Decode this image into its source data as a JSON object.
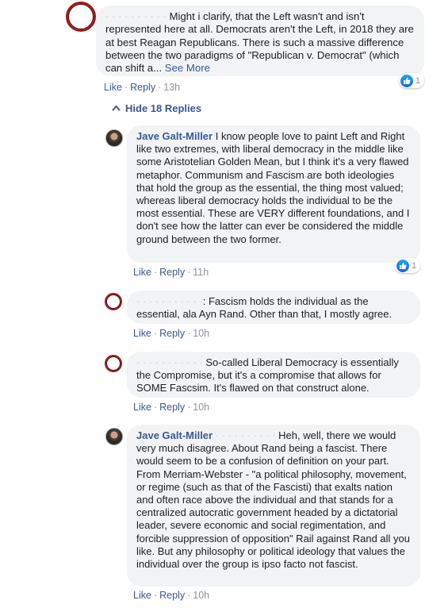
{
  "thread": {
    "top_comment": {
      "masked_name": "· · · · · · · · · ·",
      "text": " Might i clarify, that the Left wasn't and isn't represented here at all. Democrats aren't the Left, in 2018 they are at best Reagan Republicans. There is such a massive difference between the two paradigms of \"Republican v. Democrat\" (which can shift a...",
      "see_more": "See More",
      "like": "Like",
      "reply": "Reply",
      "time": "13h",
      "reaction_count": "1"
    },
    "hide_replies": "Hide 18 Replies",
    "replies": [
      {
        "author": "Jave Galt-Miller",
        "text": " I know people love to paint Left and Right like two extremes, with liberal democracy in the middle like some Aristotelian Golden Mean, but I think it's a very flawed metaphor. Communism and Fascism are both ideologies that hold the group as the essential, the thing most valued; whereas liberal democracy holds the individual to be the most essential. These are VERY different foundations, and I don't see how the latter can ever be considered the middle ground between the two former.",
        "like": "Like",
        "reply": "Reply",
        "time": "11h",
        "reaction_count": "1"
      },
      {
        "masked_name": "· · · · · · · · · · ·",
        "text": ": Fascism holds the individual as the essential, ala Ayn Rand. Other than that, I mostly agree.",
        "like": "Like",
        "reply": "Reply",
        "time": "10h"
      },
      {
        "masked_name": "· · · · · · · · · · ·",
        "text": " So-called Liberal Democracy is essentially the Compromise, but it's a compromise that allows for SOME Fascsim. It's flawed on that construct alone.",
        "like": "Like",
        "reply": "Reply",
        "time": "10h"
      },
      {
        "author": "Jave Galt-Miller",
        "masked_name": "· · · · · · · · · ·",
        "text": " Heh, well, there we would very much disagree. About Rand being a fascist. There would seem to be a confusion of definition on your part. From Merriam-Webster - \"a political philosophy, movement, or regime (such as that of the Fascisti) that exalts nation and often race above the individual and that stands for a centralized autocratic government headed by a dictatorial leader, severe economic and social regimentation, and forcible suppression of opposition\" Rail against Rand all you like. But any philosophy or political ideology that values the individual over the group is ipso facto not fascist.",
        "like": "Like",
        "reply": "Reply",
        "time": "10h"
      }
    ]
  },
  "colors": {
    "link": "#385898",
    "bubble": "#f2f3f5",
    "meta": "#90949c",
    "avatar_ring": "#a01818",
    "like_blue": "#1e63e8"
  },
  "icons": {
    "reaction": "thumbs-up-icon",
    "collapse": "chevron-up-icon"
  }
}
